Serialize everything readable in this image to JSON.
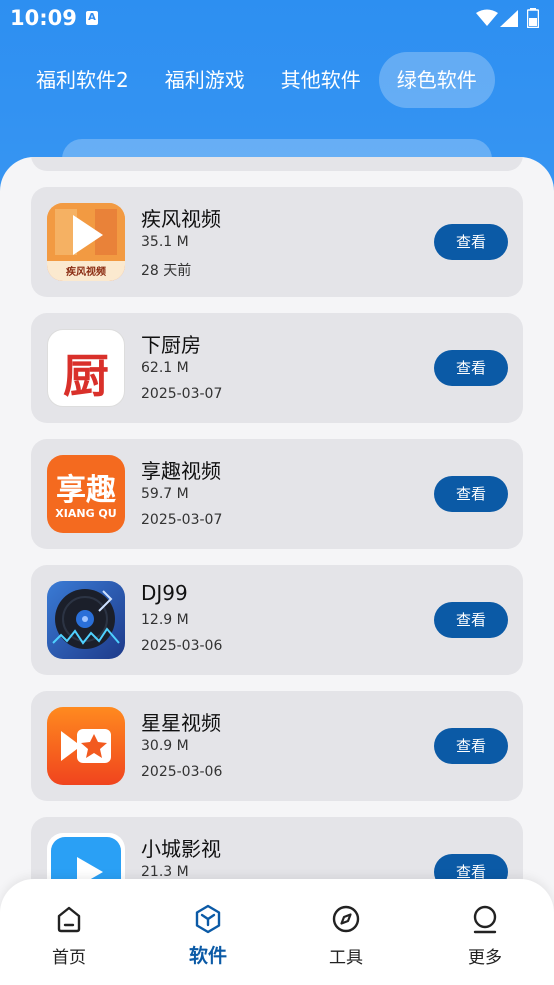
{
  "status_bar": {
    "time": "10:09",
    "notification_icon": "A"
  },
  "tabs": [
    {
      "label": "福利软件2",
      "active": false
    },
    {
      "label": "福利游戏",
      "active": false
    },
    {
      "label": "其他软件",
      "active": false
    },
    {
      "label": "绿色软件",
      "active": true
    }
  ],
  "apps": [
    {
      "name": "疾风视频",
      "size": "35.1 M",
      "date": "28 天前",
      "button": "查看",
      "icon": "play-icon",
      "icon_caption": "疾风视频"
    },
    {
      "name": "下厨房",
      "size": "62.1 M",
      "date": "2025-03-07",
      "button": "查看",
      "icon": "kitchen-icon",
      "icon_text": "厨"
    },
    {
      "name": "享趣视频",
      "size": "59.7 M",
      "date": "2025-03-07",
      "button": "查看",
      "icon": "xiangqu-icon",
      "icon_text": "享趣",
      "icon_caption": "XIANG QU"
    },
    {
      "name": "DJ99",
      "size": "12.9 M",
      "date": "2025-03-06",
      "button": "查看",
      "icon": "vinyl-icon"
    },
    {
      "name": "星星视频",
      "size": "30.9 M",
      "date": "2025-03-06",
      "button": "查看",
      "icon": "star-camera-icon"
    },
    {
      "name": "小城影视",
      "size": "21.3 M",
      "date": "",
      "button": "查看",
      "icon": "play-circle-icon"
    }
  ],
  "bottom_nav": [
    {
      "label": "首页",
      "icon": "home-icon",
      "active": false
    },
    {
      "label": "软件",
      "icon": "cube-icon",
      "active": true
    },
    {
      "label": "工具",
      "icon": "compass-icon",
      "active": false
    },
    {
      "label": "更多",
      "icon": "user-icon",
      "active": false
    }
  ],
  "colors": {
    "primary": "#2f8cf0",
    "button": "#0b5aa6",
    "card": "#e4e4e8"
  }
}
